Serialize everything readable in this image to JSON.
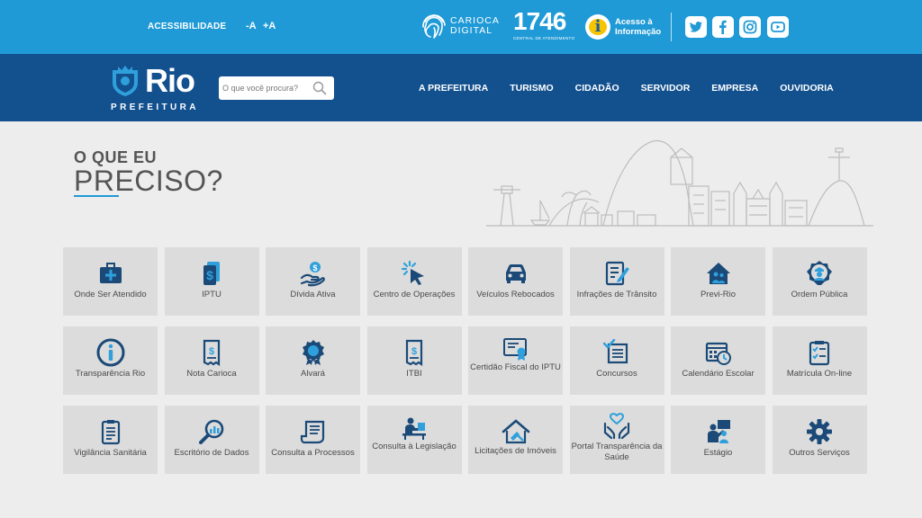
{
  "topbar": {
    "accessibility": "ACESSIBILIDADE",
    "font_minus": "-A",
    "font_plus": "+A",
    "carioca_digital": [
      "CARIOCA",
      "DIGITAL"
    ],
    "n1746": "1746",
    "n1746_sub": "CENTRAL DE ATENDIMENTO",
    "acesso_info": [
      "Acesso à",
      "Informação"
    ],
    "acesso_icon": "i",
    "social": [
      "twitter-icon",
      "facebook-icon",
      "instagram-icon",
      "youtube-icon"
    ]
  },
  "nav": {
    "logo_title": "Rio",
    "logo_subtitle": "PREFEITURA",
    "search_placeholder": "O que você procura?",
    "items": [
      "A PREFEITURA",
      "TURISMO",
      "CIDADÃO",
      "SERVIDOR",
      "EMPRESA",
      "OUVIDORIA"
    ]
  },
  "main": {
    "headline_small": "O QUE EU",
    "headline_large": "PRECISO?",
    "tiles": [
      {
        "label": "Onde Ser Atendido",
        "icon": "medical-kit-icon"
      },
      {
        "label": "IPTU",
        "icon": "dollar-document-icon"
      },
      {
        "label": "Dívida Ativa",
        "icon": "hand-coin-icon"
      },
      {
        "label": "Centro de Operações",
        "icon": "cursor-click-icon"
      },
      {
        "label": "Veículos Rebocados",
        "icon": "car-icon"
      },
      {
        "label": "Infrações de Trânsito",
        "icon": "form-pencil-icon"
      },
      {
        "label": "Previ-Rio",
        "icon": "house-people-icon"
      },
      {
        "label": "Ordem Pública",
        "icon": "badge-officer-icon"
      },
      {
        "label": "Transparência Rio",
        "icon": "info-circle-icon"
      },
      {
        "label": "Nota Carioca",
        "icon": "receipt-dollar-icon"
      },
      {
        "label": "Alvará",
        "icon": "award-seal-icon"
      },
      {
        "label": "ITBI",
        "icon": "receipt-dollar-icon"
      },
      {
        "label": "Certidão Fiscal do IPTU",
        "icon": "certificate-icon"
      },
      {
        "label": "Concursos",
        "icon": "checklist-icon"
      },
      {
        "label": "Calendário Escolar",
        "icon": "calendar-clock-icon"
      },
      {
        "label": "Matrícula On-line",
        "icon": "clipboard-checklist-icon"
      },
      {
        "label": "Vigilância Sanitária",
        "icon": "clipboard-icon"
      },
      {
        "label": "Escritório de Dados",
        "icon": "magnifier-chart-icon"
      },
      {
        "label": "Consulta a Processos",
        "icon": "scroll-document-icon"
      },
      {
        "label": "Consulta à Legislação",
        "icon": "person-desk-icon"
      },
      {
        "label": "Licitações de Imóveis",
        "icon": "house-gavel-icon"
      },
      {
        "label": "Portal Transparência da Saúde",
        "icon": "hands-heart-icon"
      },
      {
        "label": "Estágio",
        "icon": "people-board-icon"
      },
      {
        "label": "Outros Serviços",
        "icon": "gear-icon"
      }
    ]
  },
  "colors": {
    "topbar": "#1f9ad6",
    "nav": "#12508e",
    "icon_dark": "#1b4a78",
    "icon_light": "#2fa0dc",
    "tile_bg": "#dcdcdc"
  }
}
